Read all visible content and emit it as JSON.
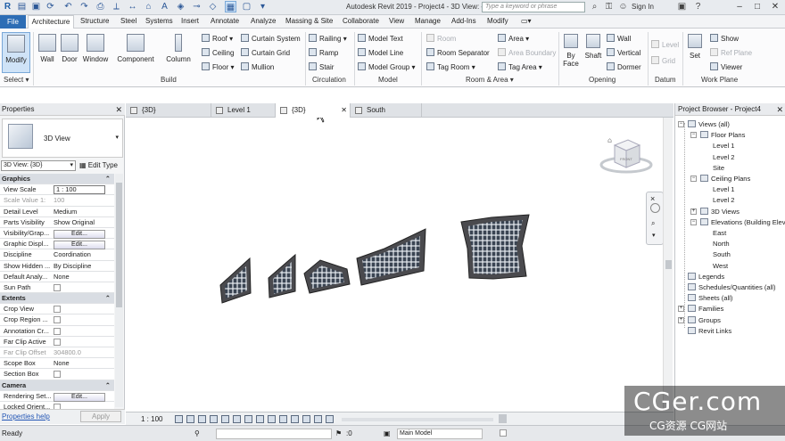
{
  "window": {
    "title": "Autodesk Revit 2019 - Project4 - 3D View: {3D}",
    "search_placeholder": "Type a keyword or phrase",
    "sign_in": "Sign In",
    "minimize": "–",
    "maximize": "□",
    "close": "✕"
  },
  "menu": {
    "file": "File",
    "tabs": [
      "Architecture",
      "Structure",
      "Steel",
      "Systems",
      "Insert",
      "Annotate",
      "Analyze",
      "Massing & Site",
      "Collaborate",
      "View",
      "Manage",
      "Add-Ins",
      "Modify"
    ]
  },
  "ribbon": {
    "modify": "Modify",
    "select": "Select",
    "select_caret": "▾",
    "wall": "Wall",
    "door": "Door",
    "window": "Window",
    "component": "Component",
    "column": "Column",
    "roof": "Roof",
    "ceiling": "Ceiling",
    "floor": "Floor",
    "curtain_system": "Curtain System",
    "curtain_grid": "Curtain Grid",
    "mullion": "Mullion",
    "build": "Build",
    "railing": "Railing",
    "ramp": "Ramp",
    "stair": "Stair",
    "circulation": "Circulation",
    "model_text": "Model Text",
    "model_line": "Model Line",
    "model_group": "Model Group",
    "model": "Model",
    "room": "Room",
    "room_separator": "Room Separator",
    "tag_room": "Tag Room",
    "area": "Area",
    "area_boundary": "Area Boundary",
    "tag_area": "Tag Area",
    "room_area": "Room & Area",
    "by_face": "By Face",
    "shaft": "Shaft",
    "wall_op": "Wall",
    "vertical": "Vertical",
    "dormer": "Dormer",
    "opening": "Opening",
    "level": "Level",
    "grid": "Grid",
    "datum": "Datum",
    "set": "Set",
    "show": "Show",
    "ref_plane": "Ref Plane",
    "viewer": "Viewer",
    "work_plane": "Work Plane"
  },
  "properties": {
    "title": "Properties",
    "close": "✕",
    "type_name": "3D View",
    "type_caret": "▾",
    "view_selector": "3D View: {3D}",
    "edit_type": "Edit Type",
    "rows": [
      {
        "kind": "sec",
        "name": "Graphics"
      },
      {
        "kind": "input",
        "name": "View Scale",
        "value": "1 : 100"
      },
      {
        "kind": "gray",
        "name": "Scale Value    1:",
        "value": "100"
      },
      {
        "kind": "text",
        "name": "Detail Level",
        "value": "Medium"
      },
      {
        "kind": "text",
        "name": "Parts Visibility",
        "value": "Show Original"
      },
      {
        "kind": "btn",
        "name": "Visibility/Grap...",
        "value": "Edit..."
      },
      {
        "kind": "btn",
        "name": "Graphic Displ...",
        "value": "Edit..."
      },
      {
        "kind": "text",
        "name": "Discipline",
        "value": "Coordination"
      },
      {
        "kind": "text",
        "name": "Show Hidden ...",
        "value": "By Discipline"
      },
      {
        "kind": "text",
        "name": "Default Analy...",
        "value": "None"
      },
      {
        "kind": "chk",
        "name": "Sun Path",
        "value": ""
      },
      {
        "kind": "sec",
        "name": "Extents"
      },
      {
        "kind": "chk",
        "name": "Crop View",
        "value": ""
      },
      {
        "kind": "chk",
        "name": "Crop Region ...",
        "value": ""
      },
      {
        "kind": "chk",
        "name": "Annotation Cr...",
        "value": ""
      },
      {
        "kind": "chk",
        "name": "Far Clip Active",
        "value": ""
      },
      {
        "kind": "gray",
        "name": "Far Clip Offset",
        "value": "304800.0"
      },
      {
        "kind": "text",
        "name": "Scope Box",
        "value": "None"
      },
      {
        "kind": "chk",
        "name": "Section Box",
        "value": ""
      },
      {
        "kind": "sec",
        "name": "Camera"
      },
      {
        "kind": "btn",
        "name": "Rendering Set...",
        "value": "Edit..."
      },
      {
        "kind": "chk",
        "name": "Locked Orient...",
        "value": ""
      }
    ],
    "help": "Properties help",
    "apply": "Apply"
  },
  "view_tabs": [
    {
      "label": "{3D}",
      "active": false
    },
    {
      "label": "Level 1",
      "active": false
    },
    {
      "label": "{3D}",
      "active": true
    },
    {
      "label": "South",
      "active": false
    }
  ],
  "view_control": {
    "scale": "1 : 100"
  },
  "browser": {
    "title": "Project Browser - Project4",
    "close": "✕",
    "nodes": [
      {
        "label": "Views (all)",
        "depth": 0,
        "tog": "−"
      },
      {
        "label": "Floor Plans",
        "depth": 1,
        "tog": "−"
      },
      {
        "label": "Level 1",
        "depth": 2,
        "tog": ""
      },
      {
        "label": "Level 2",
        "depth": 2,
        "tog": ""
      },
      {
        "label": "Site",
        "depth": 2,
        "tog": ""
      },
      {
        "label": "Ceiling Plans",
        "depth": 1,
        "tog": "−"
      },
      {
        "label": "Level 1",
        "depth": 2,
        "tog": ""
      },
      {
        "label": "Level 2",
        "depth": 2,
        "tog": ""
      },
      {
        "label": "3D Views",
        "depth": 1,
        "tog": "+"
      },
      {
        "label": "Elevations (Building Elevation)",
        "depth": 1,
        "tog": "−"
      },
      {
        "label": "East",
        "depth": 2,
        "tog": ""
      },
      {
        "label": "North",
        "depth": 2,
        "tog": ""
      },
      {
        "label": "South",
        "depth": 2,
        "tog": ""
      },
      {
        "label": "West",
        "depth": 2,
        "tog": ""
      },
      {
        "label": "Legends",
        "depth": 0,
        "tog": ""
      },
      {
        "label": "Schedules/Quantities (all)",
        "depth": 0,
        "tog": ""
      },
      {
        "label": "Sheets (all)",
        "depth": 0,
        "tog": ""
      },
      {
        "label": "Families",
        "depth": 0,
        "tog": "+"
      },
      {
        "label": "Groups",
        "depth": 0,
        "tog": "+"
      },
      {
        "label": "Revit Links",
        "depth": 0,
        "tog": ""
      }
    ]
  },
  "status": {
    "text": "Ready",
    "zero": ":0",
    "model": "Main Model"
  },
  "viewcube": {
    "face": "FRONT"
  },
  "watermark": {
    "main": "CGer.com",
    "sub": "CG资源  CG网站"
  }
}
